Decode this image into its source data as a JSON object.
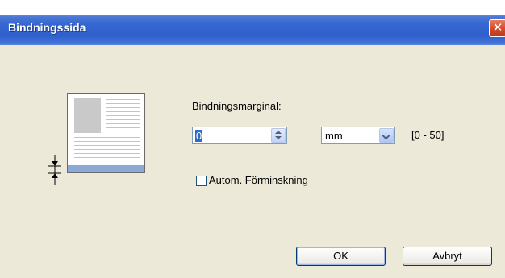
{
  "window": {
    "title": "Bindningssida",
    "close_glyph": "✕"
  },
  "form": {
    "margin_label": "Bindningsmarginal:",
    "margin_value": "0",
    "unit_value": "mm",
    "range_label": "[0 - 50]",
    "auto_reduce_label": "Autom. Förminskning",
    "auto_reduce_checked": false
  },
  "buttons": {
    "ok_label": "OK",
    "cancel_label": "Avbryt"
  },
  "icons": {
    "page": "page-binding-illustration",
    "margin": "margin-marker-icon",
    "spin": "spin-arrows-icon",
    "dropdown": "chevron-down-icon"
  }
}
